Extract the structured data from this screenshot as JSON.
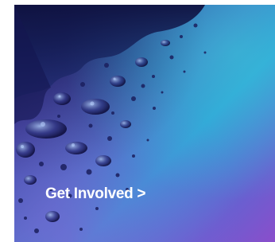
{
  "promo": {
    "cta_label": "Get Involved >"
  },
  "colors": {
    "deep_navy": "#1c1f63",
    "ocean_blue": "#3e7fc9",
    "turquoise": "#2fa0d8",
    "violet": "#8a4ecb",
    "text": "#ffffff"
  },
  "icons": {
    "background": "water-bubbles-image"
  }
}
